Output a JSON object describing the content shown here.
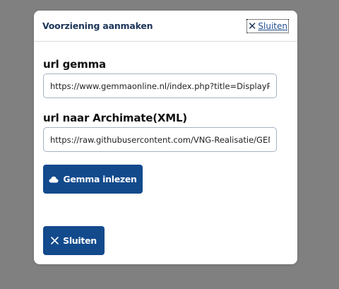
{
  "modal": {
    "title": "Voorziening aanmaken",
    "header_close_label": "Sluiten",
    "fields": [
      {
        "label": "url gemma",
        "value": "https://www.gemmaonline.nl/index.php?title=DisplayPage"
      },
      {
        "label": "url naar Archimate(XML)",
        "value": "https://raw.githubusercontent.com/VNG-Realisatie/GEMMA-Archi-repository"
      }
    ],
    "load_button_label": "Gemma inlezen",
    "close_button_label": "Sluiten"
  },
  "colors": {
    "overlay": "#808080",
    "primary": "#124a8c",
    "title": "#1c3559"
  },
  "icons": {
    "header_close": "close-icon",
    "load_button": "cloud-icon",
    "close_button": "close-icon"
  }
}
